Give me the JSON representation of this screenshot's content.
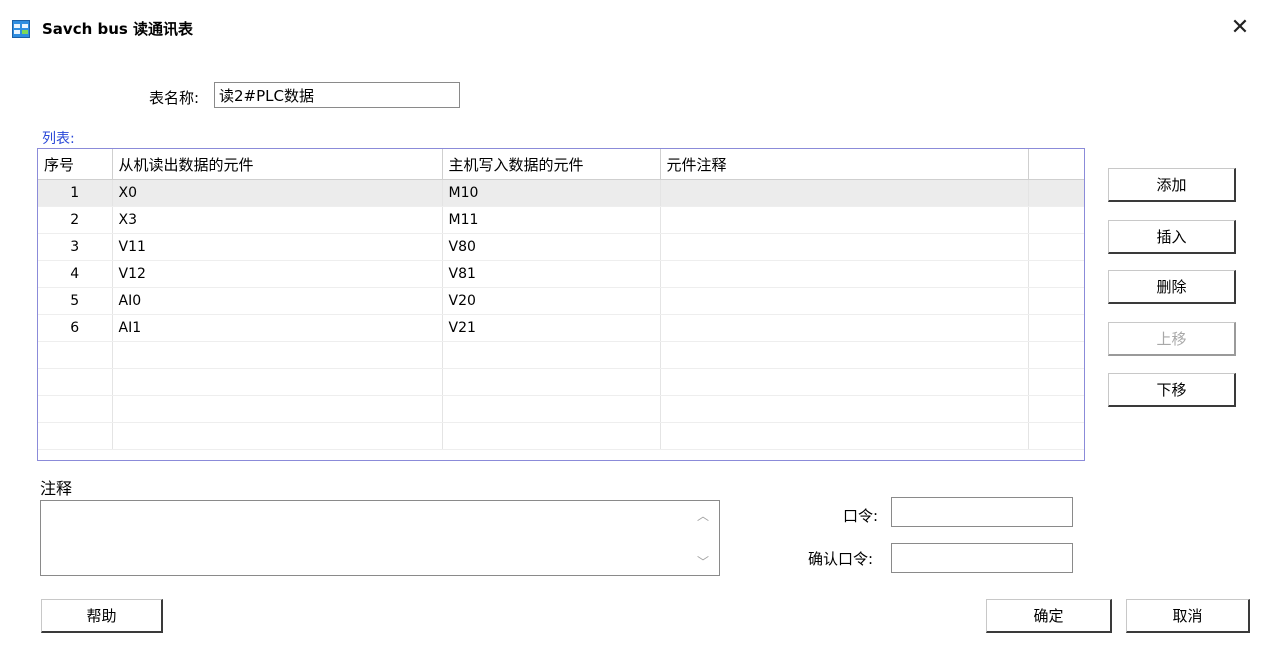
{
  "window": {
    "title": "Savch bus  读通讯表",
    "close_glyph": "✕"
  },
  "table_name": {
    "label": "表名称:",
    "value": "读2#PLC数据"
  },
  "list": {
    "caption": "列表:",
    "columns": [
      "序号",
      "从机读出数据的元件",
      "主机写入数据的元件",
      "元件注释",
      ""
    ],
    "rows": [
      {
        "no": "1",
        "read": "X0",
        "write": "M10",
        "comment": ""
      },
      {
        "no": "2",
        "read": "X3",
        "write": "M11",
        "comment": ""
      },
      {
        "no": "3",
        "read": "V11",
        "write": "V80",
        "comment": ""
      },
      {
        "no": "4",
        "read": "V12",
        "write": "V81",
        "comment": ""
      },
      {
        "no": "5",
        "read": "AI0",
        "write": "V20",
        "comment": ""
      },
      {
        "no": "6",
        "read": "AI1",
        "write": "V21",
        "comment": ""
      }
    ],
    "selected_row": 1
  },
  "side_buttons": {
    "add": "添加",
    "insert": "插入",
    "delete": "删除",
    "move_up": "上移",
    "move_down": "下移"
  },
  "notes": {
    "label": "注释",
    "value": ""
  },
  "password": {
    "label": "口令:",
    "value": ""
  },
  "confirm_password": {
    "label": "确认口令:",
    "value": ""
  },
  "footer": {
    "help": "帮助",
    "ok": "确定",
    "cancel": "取消"
  },
  "icons": {
    "app": "table-grid-icon",
    "close": "close-icon",
    "scroll_up": "chevron-up-icon",
    "scroll_down": "chevron-down-icon"
  },
  "colors": {
    "caption": "#2a48d8",
    "list_border": "#8b8bd9",
    "selected_row": "#ececec"
  }
}
